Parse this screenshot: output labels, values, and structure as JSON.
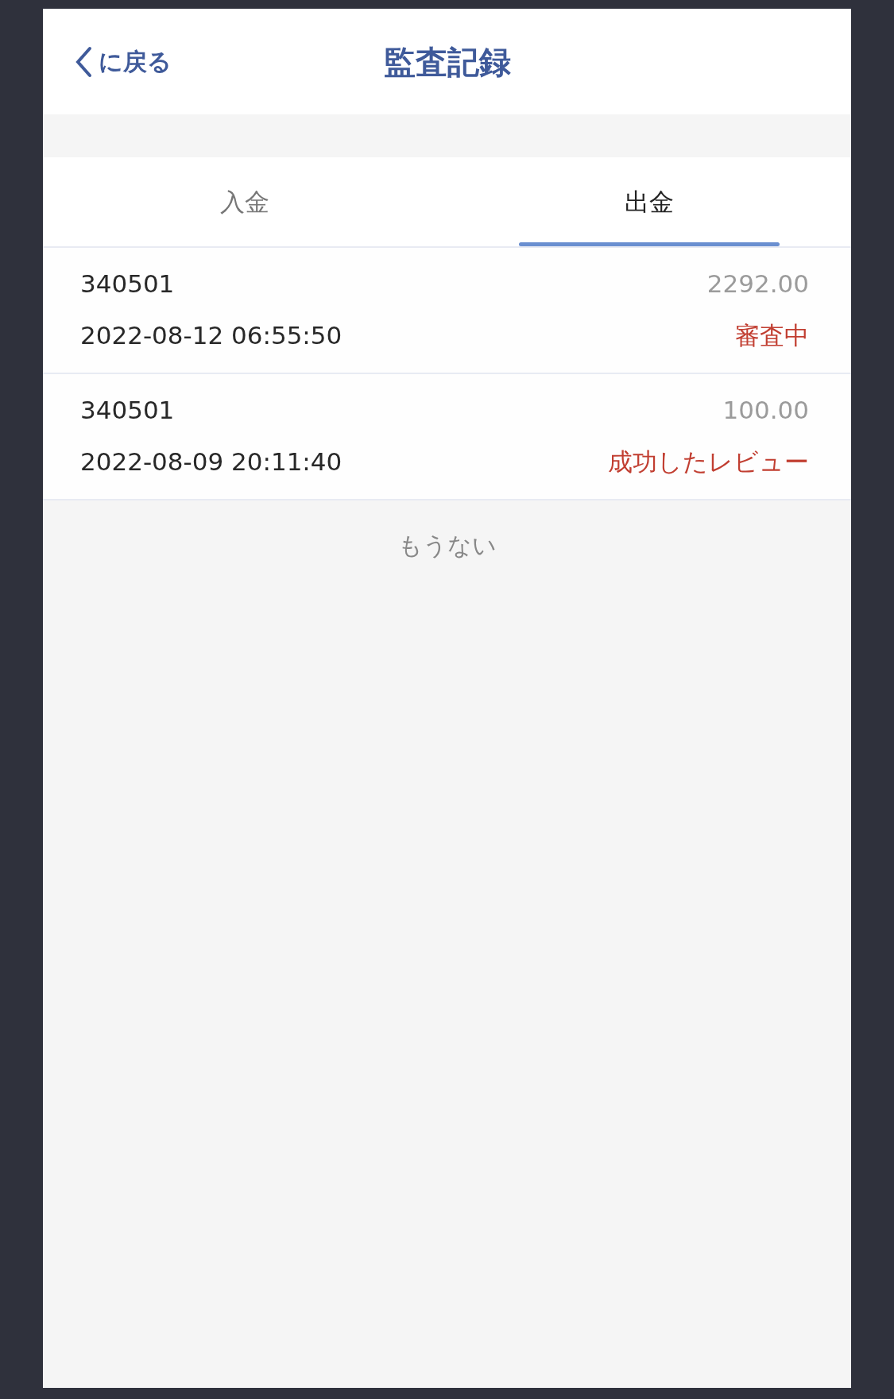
{
  "header": {
    "back_label": "に戻る",
    "title": "監査記録"
  },
  "tabs": [
    {
      "label": "入金",
      "selected": false
    },
    {
      "label": "出金",
      "selected": true
    }
  ],
  "records": [
    {
      "id": "340501",
      "amount": "2292.00",
      "time": "2022-08-12 06:55:50",
      "status": "審査中"
    },
    {
      "id": "340501",
      "amount": "100.00",
      "time": "2022-08-09 20:11:40",
      "status": "成功したレビュー"
    }
  ],
  "end_note": "もうない"
}
